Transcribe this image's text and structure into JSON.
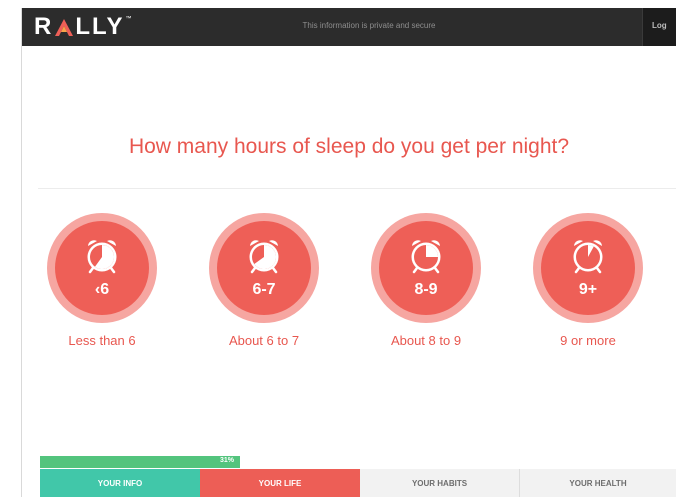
{
  "header": {
    "logo_left": "R",
    "logo_right": "LLY",
    "logo_tm": "™",
    "privacy_text": "This information is private and secure",
    "login_label": "Log"
  },
  "question": "How many hours of sleep do you get per night?",
  "options": [
    {
      "badge": "‹6",
      "label": "Less than 6",
      "icon": "alarm-clock-icon",
      "clock_fill_fraction": 0.6
    },
    {
      "badge": "6-7",
      "label": "About 6 to 7",
      "icon": "alarm-clock-icon",
      "clock_fill_fraction": 0.65
    },
    {
      "badge": "8-9",
      "label": "About 8 to 9",
      "icon": "alarm-clock-icon",
      "clock_fill_fraction": 0.25
    },
    {
      "badge": "9+",
      "label": "9 or more",
      "icon": "alarm-clock-icon",
      "clock_fill_fraction": 0.08
    }
  ],
  "progress": {
    "percent": 31,
    "label": "31%"
  },
  "tabs": [
    {
      "label": "YOUR INFO"
    },
    {
      "label": "YOUR LIFE"
    },
    {
      "label": "YOUR HABITS"
    },
    {
      "label": "YOUR HEALTH"
    }
  ],
  "colors": {
    "accent": "#ee5f57",
    "ring": "#f6a6a1",
    "progress": "#53c47d",
    "info_tab": "#41c7a9",
    "header": "#2c2c2c"
  }
}
